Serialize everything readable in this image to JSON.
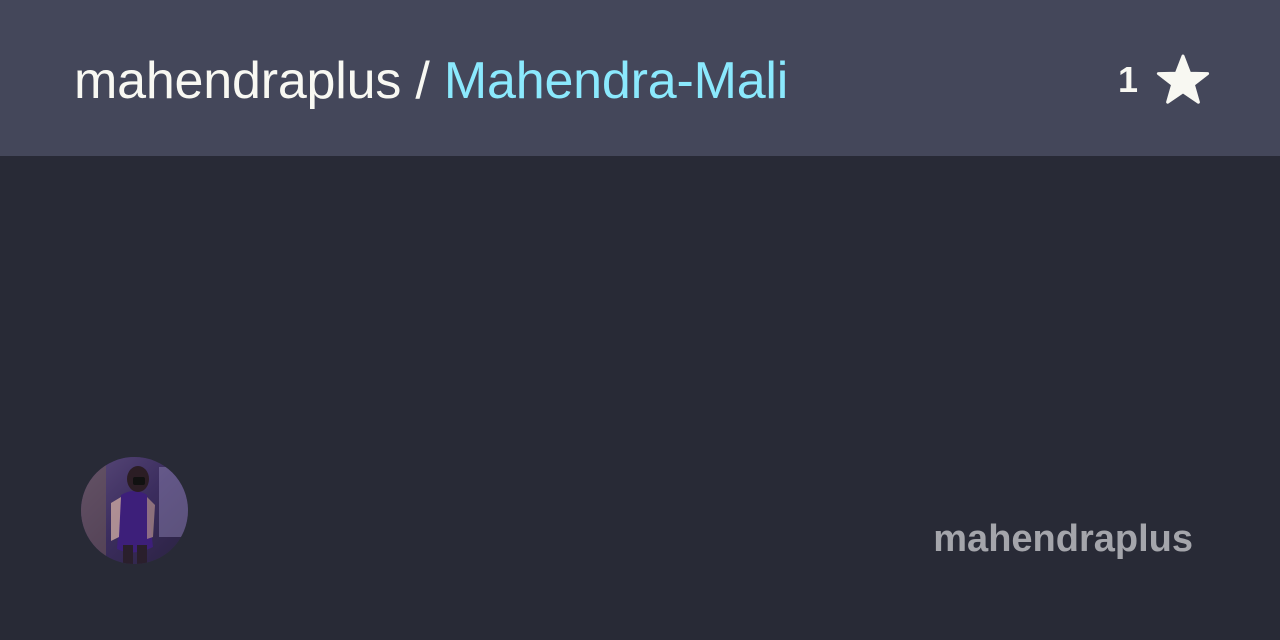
{
  "header": {
    "owner": "mahendraplus",
    "separator": " / ",
    "repo": "Mahendra-Mali",
    "star_count": "1",
    "star_icon": "star-icon"
  },
  "footer": {
    "username": "mahendraplus",
    "avatar_icon": "avatar"
  },
  "colors": {
    "header_bg": "#44475a",
    "body_bg": "#282a36",
    "owner_text": "#f8f8f2",
    "repo_text": "#8be9fd",
    "username_text": "#a4a5ab"
  }
}
